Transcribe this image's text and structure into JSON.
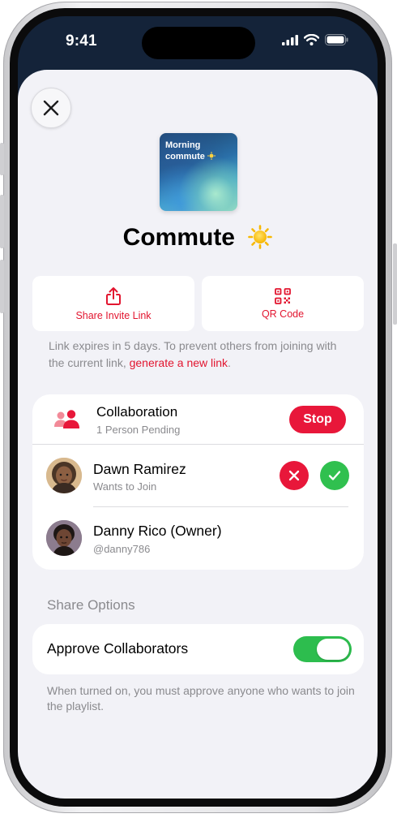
{
  "status_bar": {
    "time": "9:41"
  },
  "playlist": {
    "artwork_text": "Morning commute",
    "title": "Commute"
  },
  "actions": {
    "share_invite": "Share Invite Link",
    "qr_code": "QR Code"
  },
  "link_info": {
    "text": "Link expires in 5 days. To prevent others from joining with the current link, ",
    "link_text": "generate a new link",
    "end": "."
  },
  "collaboration": {
    "title": "Collaboration",
    "subtitle": "1 Person Pending",
    "stop_label": "Stop",
    "people": [
      {
        "name": "Dawn Ramirez",
        "subtitle": "Wants to Join"
      },
      {
        "name": "Danny Rico (Owner)",
        "subtitle": "@danny786"
      }
    ]
  },
  "share_options": {
    "header": "Share Options",
    "approve_label": "Approve Collaborators",
    "approve_on": true,
    "footer": "When turned on, you must approve anyone who wants to join the playlist."
  },
  "colors": {
    "accent_red": "#e2152f",
    "stop_red": "#e8173a",
    "toggle_green": "#2dbd4e",
    "approve_green": "#30c04f"
  }
}
